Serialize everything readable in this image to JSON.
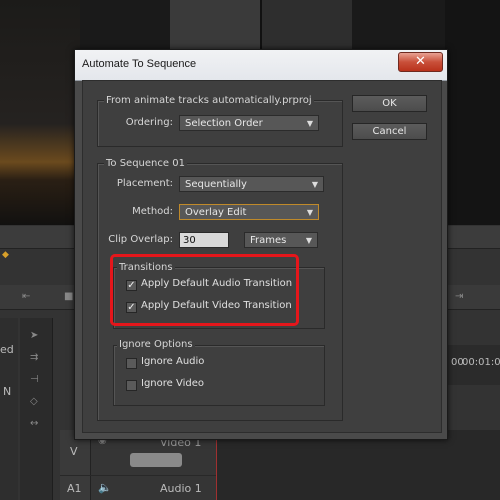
{
  "background": {
    "bar1_time": "00",
    "timecode": "00:01:0",
    "left_text": "ed",
    "left_letter": "N",
    "track_video_label": "V",
    "track_video_name": "Video 1",
    "track_audio_label": "A1",
    "track_audio_name": "Audio 1"
  },
  "dialog": {
    "title": "Automate To Sequence",
    "close_label": "✕",
    "from_group": {
      "label": "From  animate tracks automatically.prproj",
      "ordering_label": "Ordering:",
      "ordering_value": "Selection Order"
    },
    "to_group": {
      "label": "To Sequence 01",
      "placement_label": "Placement:",
      "placement_value": "Sequentially",
      "method_label": "Method:",
      "method_value": "Overlay Edit",
      "clip_overlap_label": "Clip Overlap:",
      "clip_overlap_value": "30",
      "clip_overlap_unit": "Frames"
    },
    "transitions": {
      "label": "Transitions",
      "audio_label": "Apply Default Audio Transition",
      "audio_checked": true,
      "video_label": "Apply Default Video Transition",
      "video_checked": true
    },
    "ignore": {
      "label": "Ignore Options",
      "audio_label": "Ignore Audio",
      "audio_checked": false,
      "video_label": "Ignore Video",
      "video_checked": false
    },
    "ok_label": "OK",
    "cancel_label": "Cancel",
    "check_glyph": "✓",
    "caret_glyph": "▼"
  },
  "colors": {
    "highlight": "#e5161b",
    "dialog_bg": "#3f3f3f",
    "active_border": "#c08a2a"
  }
}
